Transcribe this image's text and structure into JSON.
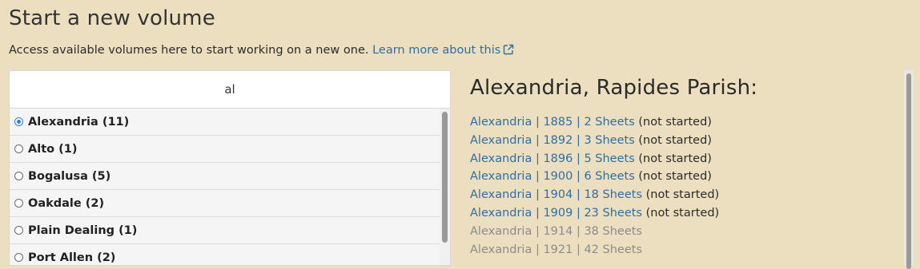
{
  "header": {
    "title": "Start a new volume",
    "intro_text": "Access available volumes here to start working on a new one.",
    "learn_more_link": "Learn more about this",
    "learn_more_icon": "external-link-icon"
  },
  "search": {
    "value": "al",
    "placeholder": ""
  },
  "places": {
    "items": [
      {
        "label": "Alexandria (11)",
        "selected": true
      },
      {
        "label": "Alto (1)",
        "selected": false
      },
      {
        "label": "Bogalusa (5)",
        "selected": false
      },
      {
        "label": "Oakdale (2)",
        "selected": false
      },
      {
        "label": "Plain Dealing (1)",
        "selected": false
      },
      {
        "label": "Port Allen (2)",
        "selected": false
      }
    ]
  },
  "detail": {
    "heading": "Alexandria, Rapides Parish:",
    "volumes": [
      {
        "link": "Alexandria | 1885 | 2 Sheets",
        "status": "(not started)"
      },
      {
        "link": "Alexandria | 1892 | 3 Sheets",
        "status": "(not started)"
      },
      {
        "link": "Alexandria | 1896 | 5 Sheets",
        "status": "(not started)"
      },
      {
        "link": "Alexandria | 1900 | 6 Sheets",
        "status": "(not started)"
      },
      {
        "link": "Alexandria | 1904 | 18 Sheets",
        "status": "(not started)"
      },
      {
        "link": "Alexandria | 1909 | 23 Sheets",
        "status": "(not started)"
      }
    ],
    "unavailable_volumes": [
      "Alexandria | 1914 | 38 Sheets",
      "Alexandria | 1921 | 42 Sheets"
    ]
  },
  "colors": {
    "background": "#ebdfc0",
    "link": "#2c6fa8",
    "unavailable": "#8c8c8c",
    "radio_selected": "#2f7fd6"
  }
}
